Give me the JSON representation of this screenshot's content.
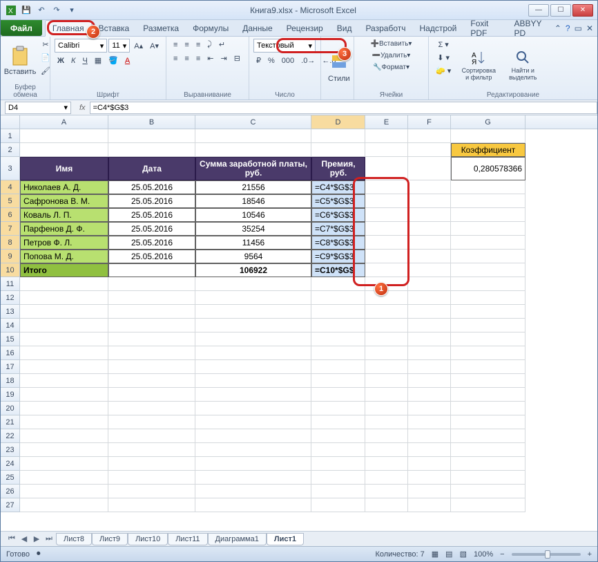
{
  "app": {
    "title": "Книга9.xlsx - Microsoft Excel"
  },
  "tabs": {
    "file": "Файл",
    "list": [
      "Главная",
      "Вставка",
      "Разметка",
      "Формулы",
      "Данные",
      "Рецензир",
      "Вид",
      "Разработч",
      "Надстрой",
      "Foxit PDF",
      "ABBYY PD"
    ],
    "active": 0
  },
  "ribbon": {
    "clipboard": {
      "paste": "Вставить",
      "label": "Буфер обмена"
    },
    "font": {
      "name": "Calibri",
      "size": "11",
      "label": "Шрифт"
    },
    "align": {
      "label": "Выравнивание"
    },
    "number": {
      "format": "Текстовый",
      "label": "Число"
    },
    "styles": {
      "label": "Стили"
    },
    "cells": {
      "insert": "Вставить",
      "delete": "Удалить",
      "format": "Формат",
      "label": "Ячейки"
    },
    "editing": {
      "sort": "Сортировка и фильтр",
      "find": "Найти и выделить",
      "label": "Редактирование"
    }
  },
  "fbar": {
    "name": "D4",
    "fx": "fx",
    "formula": "=C4*$G$3"
  },
  "cols": [
    "A",
    "B",
    "C",
    "D",
    "E",
    "F",
    "G"
  ],
  "headers": {
    "name": "Имя",
    "date": "Дата",
    "salary": "Сумма заработной платы, руб.",
    "bonus": "Премия, руб.",
    "koef": "Коэффициент"
  },
  "koef_value": "0,280578366",
  "data": [
    {
      "name": "Николаев А. Д.",
      "date": "25.05.2016",
      "salary": "21556",
      "bonus": "=C4*$G$3"
    },
    {
      "name": "Сафронова В. М.",
      "date": "25.05.2016",
      "salary": "18546",
      "bonus": "=C5*$G$3"
    },
    {
      "name": "Коваль Л. П.",
      "date": "25.05.2016",
      "salary": "10546",
      "bonus": "=C6*$G$3"
    },
    {
      "name": "Парфенов Д. Ф.",
      "date": "25.05.2016",
      "salary": "35254",
      "bonus": "=C7*$G$3"
    },
    {
      "name": "Петров Ф. Л.",
      "date": "25.05.2016",
      "salary": "11456",
      "bonus": "=C8*$G$3"
    },
    {
      "name": "Попова М. Д.",
      "date": "25.05.2016",
      "salary": "9564",
      "bonus": "=C9*$G$3"
    }
  ],
  "total": {
    "label": "Итого",
    "salary": "106922",
    "bonus": "=C10*$G$"
  },
  "sheets": {
    "list": [
      "Лист8",
      "Лист9",
      "Лист10",
      "Лист11",
      "Диаграмма1",
      "Лист1"
    ],
    "active": 5
  },
  "status": {
    "ready": "Готово",
    "count_label": "Количество:",
    "count": "7",
    "zoom": "100%"
  },
  "callouts": {
    "c1": "1",
    "c2": "2",
    "c3": "3"
  }
}
